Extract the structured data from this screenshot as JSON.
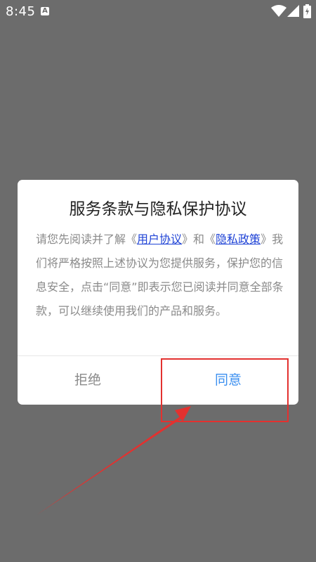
{
  "status_bar": {
    "time": "8:45",
    "notification_icon": "A"
  },
  "dialog": {
    "title": "服务条款与隐私保护协议",
    "body_part1": "请您先阅读并了解《",
    "link_user_agreement": "用户协议",
    "body_part2": "》和《",
    "link_privacy_policy": "隐私政策",
    "body_part3": "》我们将严格按照上述协议为您提供服务，保护您的信息安全，点击“同意”即表示您已阅读并同意全部条款，可以继续使用我们的产品和服务。",
    "reject_label": "拒绝",
    "agree_label": "同意"
  },
  "annotation": {
    "color": "#e3312f"
  }
}
